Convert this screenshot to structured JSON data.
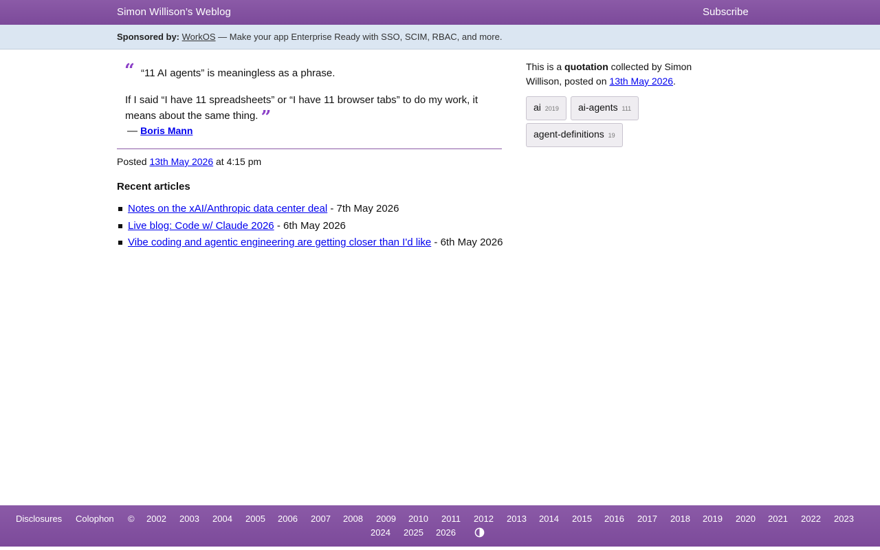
{
  "header": {
    "site_title": "Simon Willison’s Weblog",
    "subscribe": "Subscribe"
  },
  "sponsor": {
    "label": "Sponsored by:",
    "link": "WorkOS",
    "text": "— Make your app Enterprise Ready with SSO, SCIM, RBAC, and more."
  },
  "quote": {
    "line1": "“11 AI agents” is meaningless as a phrase.",
    "line2": "If I said “I have 11 spreadsheets” or “I have 11 browser tabs” to do my work, it means about the same thing.",
    "open_mark": "“",
    "close_mark": "”",
    "cite_dash": "—",
    "cite_name": "Boris Mann"
  },
  "posted": {
    "prefix": "Posted",
    "date": "13th May 2026",
    "time": "at 4:15 pm"
  },
  "recent": {
    "heading": "Recent articles",
    "items": [
      {
        "title": "Notes on the xAI/Anthropic data center deal",
        "date": "- 7th May 2026"
      },
      {
        "title": "Live blog: Code w/ Claude 2026",
        "date": "- 6th May 2026"
      },
      {
        "title": "Vibe coding and agentic engineering are getting closer than I'd like",
        "date": "- 6th May 2026"
      }
    ]
  },
  "sidebar": {
    "intro_prefix": "This is a",
    "intro_bold": "quotation",
    "intro_mid": "collected by Simon Willison, posted on",
    "intro_date": "13th May 2026",
    "intro_end": ".",
    "tags": [
      {
        "name": "ai",
        "count": "2019"
      },
      {
        "name": "ai-agents",
        "count": "111"
      },
      {
        "name": "agent-definitions",
        "count": "19"
      }
    ]
  },
  "footer": {
    "disclosures": "Disclosures",
    "colophon": "Colophon",
    "copyright": "©",
    "years": [
      "2002",
      "2003",
      "2004",
      "2005",
      "2006",
      "2007",
      "2008",
      "2009",
      "2010",
      "2011",
      "2012",
      "2013",
      "2014",
      "2015",
      "2016",
      "2017",
      "2018",
      "2019",
      "2020",
      "2021",
      "2022",
      "2023",
      "2024",
      "2025",
      "2026"
    ],
    "theme_icon": "contrast-icon"
  }
}
